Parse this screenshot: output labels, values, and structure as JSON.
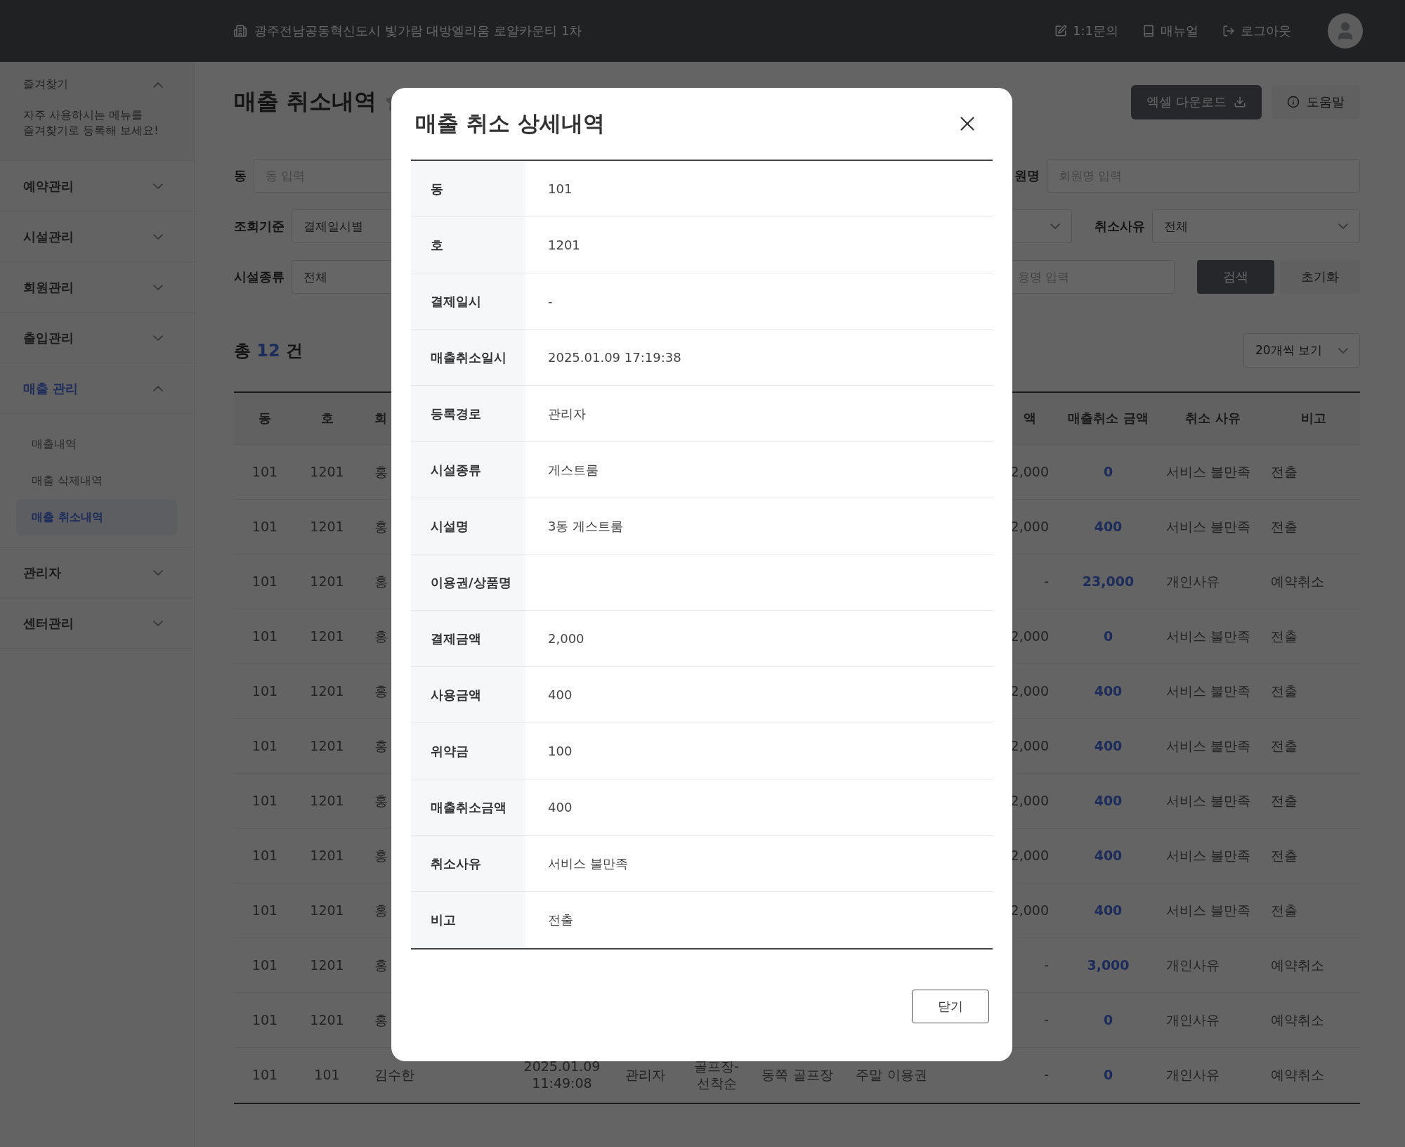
{
  "topbar": {
    "site_name": "광주전남공동혁신도시 빛가람 대방엘리움 로얄카운티 1차",
    "links": [
      {
        "kind": "inquiry",
        "label": "1:1문의"
      },
      {
        "kind": "manual",
        "label": "매뉴얼"
      },
      {
        "kind": "logout",
        "label": "로그아웃"
      }
    ]
  },
  "sidebar": {
    "favorites": {
      "title": "즐겨찾기",
      "expanded": true,
      "hint": "자주 사용하시는 메뉴를\n즐겨찾기로 등록해 보세요!"
    },
    "items": [
      {
        "label": "예약관리",
        "expanded": false,
        "selected": false
      },
      {
        "label": "시설관리",
        "expanded": false,
        "selected": false
      },
      {
        "label": "회원관리",
        "expanded": false,
        "selected": false
      },
      {
        "label": "출입관리",
        "expanded": false,
        "selected": false
      },
      {
        "label": "매출 관리",
        "expanded": true,
        "selected": true,
        "children": [
          {
            "label": "매출내역",
            "selected": false
          },
          {
            "label": "매출 삭제내역",
            "selected": false
          },
          {
            "label": "매출 취소내역",
            "selected": true
          }
        ]
      },
      {
        "label": "관리자",
        "expanded": false,
        "selected": false
      },
      {
        "label": "센터관리",
        "expanded": false,
        "selected": false
      }
    ]
  },
  "page": {
    "title": "매출 취소내역",
    "actions": [
      {
        "kind": "download",
        "label": "엑셀 다운로드"
      },
      {
        "kind": "help",
        "label": "도움말"
      }
    ]
  },
  "filter_rows": [
    {
      "left": {
        "label": "동",
        "placeholder": "동 입력"
      },
      "right": [
        {
          "kind": "input",
          "label": "원명",
          "placeholder": "회원명 입력"
        }
      ]
    },
    {
      "left": {
        "label": "조회기준",
        "value": "결제일시별"
      },
      "right": [
        {
          "kind": "select"
        },
        {
          "kind": "select",
          "label": "취소사유",
          "value": "전체"
        }
      ]
    },
    {
      "left": {
        "label": "시설종류",
        "value": "전체"
      },
      "right": [
        {
          "kind": "input",
          "placeholder": "용명 입력"
        },
        {
          "kind": "button",
          "label": "검색",
          "primary": true
        },
        {
          "kind": "button",
          "label": "초기화",
          "primary": false
        }
      ]
    }
  ],
  "summary": {
    "prefix": "총",
    "count": "12",
    "suffix": "건",
    "page_size": "20개씩 보기"
  },
  "table": {
    "columns": [
      "동",
      "호",
      "회",
      null,
      null,
      null,
      null,
      null,
      "액",
      "매출취소 금액",
      "취소 사유",
      "비고"
    ],
    "rows": [
      [
        "101",
        "1201",
        "홍",
        null,
        null,
        null,
        null,
        null,
        "2,000",
        "0",
        "서비스 불만족",
        "전출"
      ],
      [
        "101",
        "1201",
        "홍",
        null,
        null,
        null,
        null,
        null,
        "2,000",
        "400",
        "서비스 불만족",
        "전출"
      ],
      [
        "101",
        "1201",
        "홍",
        null,
        null,
        null,
        null,
        null,
        "-",
        "23,000",
        "개인사유",
        "예약취소"
      ],
      [
        "101",
        "1201",
        "홍",
        null,
        null,
        null,
        null,
        null,
        "2,000",
        "0",
        "서비스 불만족",
        "전출"
      ],
      [
        "101",
        "1201",
        "홍",
        null,
        null,
        null,
        null,
        null,
        "2,000",
        "400",
        "서비스 불만족",
        "전출"
      ],
      [
        "101",
        "1201",
        "홍",
        null,
        null,
        null,
        null,
        null,
        "2,000",
        "400",
        "서비스 불만족",
        "전출"
      ],
      [
        "101",
        "1201",
        "홍",
        null,
        null,
        null,
        null,
        null,
        "2,000",
        "400",
        "서비스 불만족",
        "전출"
      ],
      [
        "101",
        "1201",
        "홍",
        null,
        null,
        null,
        null,
        null,
        "2,000",
        "400",
        "서비스 불만족",
        "전출"
      ],
      [
        "101",
        "1201",
        "홍",
        null,
        null,
        null,
        null,
        null,
        "2,000",
        "400",
        "서비스 불만족",
        "전출"
      ],
      [
        "101",
        "1201",
        "홍",
        null,
        null,
        null,
        null,
        null,
        "-",
        "3,000",
        "개인사유",
        "예약취소"
      ],
      [
        "101",
        "1201",
        "홍",
        null,
        null,
        null,
        null,
        null,
        "-",
        "0",
        "개인사유",
        "예약취소"
      ],
      [
        "101",
        "101",
        "김수한",
        "2025.01.09 11:49:08",
        "관리자",
        "골프장-선착순",
        "동쪽 골프장",
        "주말 이용권",
        "-",
        "0",
        "개인사유",
        "예약취소"
      ]
    ]
  },
  "modal": {
    "title": "매출 취소 상세내역",
    "rows": [
      {
        "label": "동",
        "value": "101"
      },
      {
        "label": "호",
        "value": "1201"
      },
      {
        "label": "결제일시",
        "value": "-"
      },
      {
        "label": "매출취소일시",
        "value": "2025.01.09 17:19:38"
      },
      {
        "label": "등록경로",
        "value": "관리자"
      },
      {
        "label": "시설종류",
        "value": "게스트룸"
      },
      {
        "label": "시설명",
        "value": "3동 게스트룸"
      },
      {
        "label": "이용권/상품명"
      },
      {
        "label": "결제금액",
        "value": "2,000"
      },
      {
        "label": "사용금액",
        "value": "400"
      },
      {
        "label": "위약금",
        "value": "100"
      },
      {
        "label": "매출취소금액",
        "value": "400"
      },
      {
        "label": "취소사유",
        "value": "서비스 불만족"
      },
      {
        "label": "비고",
        "value": "전출"
      }
    ],
    "close_label": "닫기"
  }
}
